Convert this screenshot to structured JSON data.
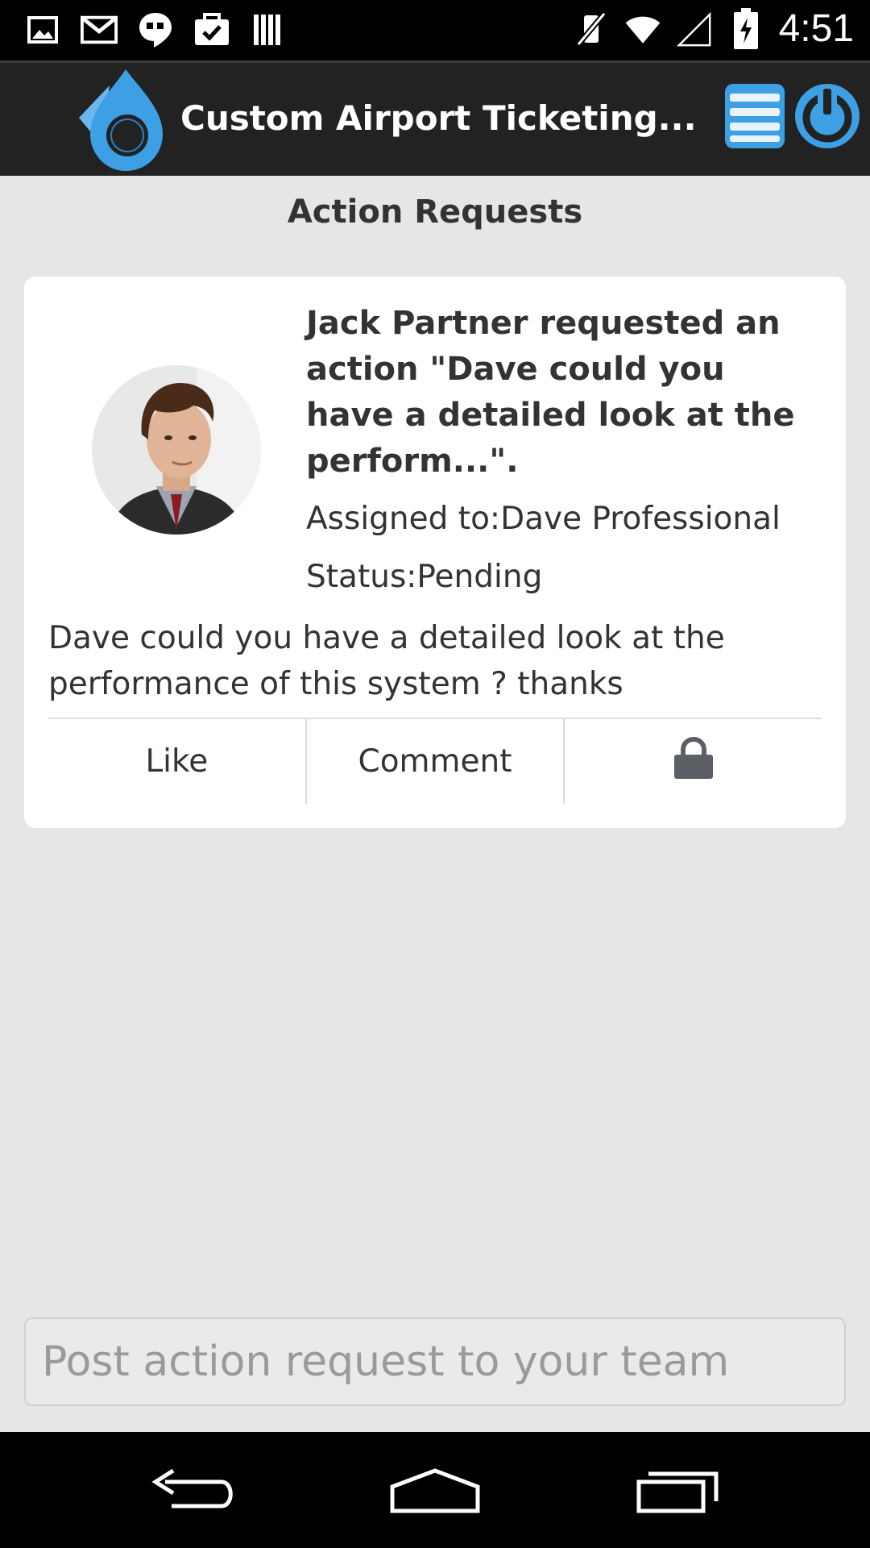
{
  "status_bar": {
    "time": "4:51",
    "left_icons": [
      "gallery-icon",
      "gmail-icon",
      "hangouts-icon",
      "tasks-icon",
      "barcode-icon"
    ],
    "right_icons": [
      "vibrate-off-icon",
      "wifi-icon",
      "signal-icon",
      "battery-charging-icon"
    ]
  },
  "app_bar": {
    "title": "Custom Airport Ticketing...",
    "logo_icon": "app-logo-icon",
    "menu_icon": "menu-icon",
    "power_icon": "power-icon",
    "accent_color": "#3d9fe4"
  },
  "page": {
    "title": "Action Requests"
  },
  "card": {
    "headline": "Jack Partner requested an action \"Dave could you have a detailed look at the perform...\".",
    "assigned": "Assigned to:Dave Professional",
    "status": "Status:Pending",
    "body": "Dave could you have a detailed look at the performance of this system ? thanks",
    "actions": {
      "like": "Like",
      "comment": "Comment",
      "lock_icon": "lock-icon"
    }
  },
  "composer": {
    "placeholder": "Post action request to your team"
  },
  "nav_bar": {
    "icons": [
      "back-icon",
      "home-icon",
      "recents-icon"
    ]
  }
}
